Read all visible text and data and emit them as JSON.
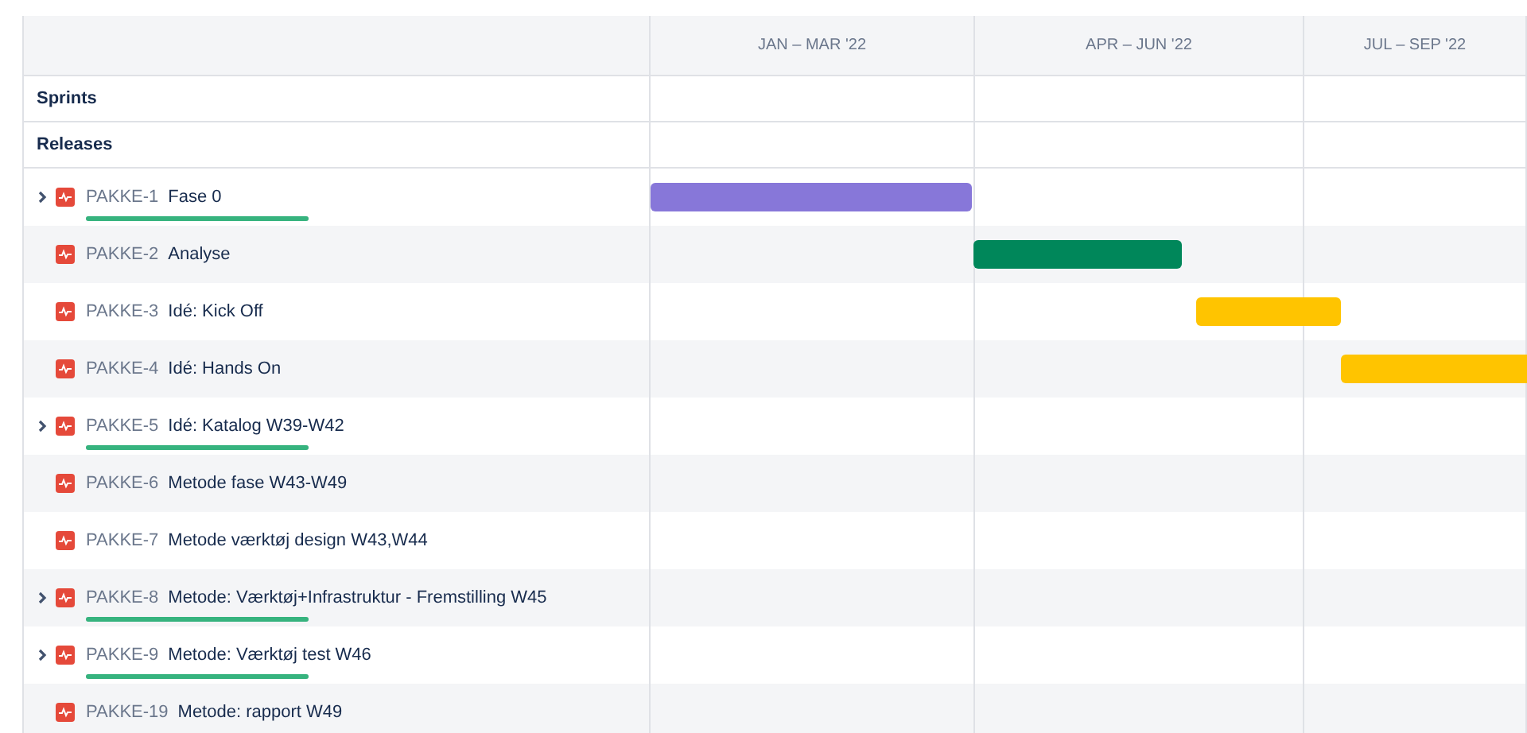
{
  "timeline": {
    "columns": [
      "JAN – MAR '22",
      "APR – JUN '22",
      "JUL – SEP '22"
    ]
  },
  "sections": [
    "Sprints",
    "Releases"
  ],
  "issues": [
    {
      "key": "PAKKE-1",
      "summary": "Fase 0",
      "expandable": true,
      "level": 1,
      "color": "#8777d9"
    },
    {
      "key": "PAKKE-2",
      "summary": "Analyse",
      "expandable": false,
      "color": "#00875a"
    },
    {
      "key": "PAKKE-3",
      "summary": "Idé: Kick Off",
      "expandable": false,
      "color": "#ffc400"
    },
    {
      "key": "PAKKE-4",
      "summary": "Idé: Hands On",
      "expandable": false,
      "color": "#ffc400"
    },
    {
      "key": "PAKKE-5",
      "summary": "Idé: Katalog W39-W42",
      "expandable": true,
      "level": 1
    },
    {
      "key": "PAKKE-6",
      "summary": "Metode fase W43-W49",
      "expandable": false
    },
    {
      "key": "PAKKE-7",
      "summary": "Metode værktøj design W43,W44",
      "expandable": false
    },
    {
      "key": "PAKKE-8",
      "summary": "Metode: Værktøj+Infrastruktur - Fremstilling W45",
      "expandable": true,
      "level": 1
    },
    {
      "key": "PAKKE-9",
      "summary": "Metode: Værktøj test W46",
      "expandable": true,
      "level": 1
    },
    {
      "key": "PAKKE-19",
      "summary": "Metode: rapport W49",
      "expandable": false
    }
  ]
}
